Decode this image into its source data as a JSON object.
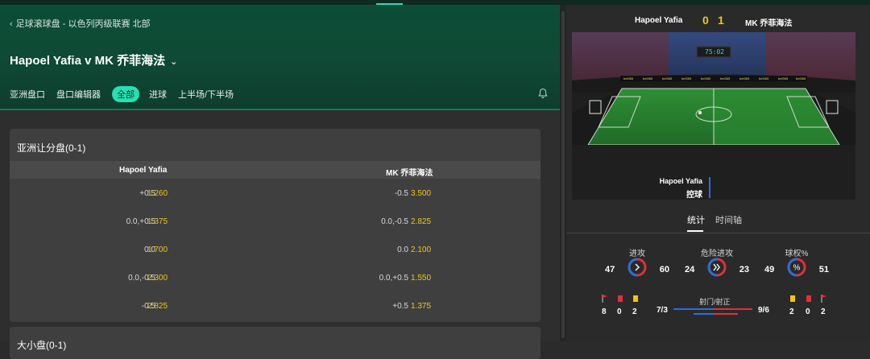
{
  "breadcrumb": "足球滚球盘 - 以色列丙级联赛 北部",
  "match_title": "Hapoel Yafia v MK 乔菲海法",
  "tabs": [
    {
      "label": "亚洲盘口",
      "active": false
    },
    {
      "label": "盘口编辑器",
      "active": false
    },
    {
      "label": "全部",
      "active": true
    },
    {
      "label": "进球",
      "active": false
    },
    {
      "label": "上半场/下半场",
      "active": false
    }
  ],
  "market": {
    "title": "亚洲让分盘(0-1)",
    "home_col": "Hapoel Yafia",
    "away_col": "MK 乔菲海法",
    "rows": [
      {
        "home_line": "+0.5",
        "home_odds": "1.260",
        "away_line": "-0.5",
        "away_odds": "3.500"
      },
      {
        "home_line": "0.0,+0.5",
        "home_odds": "1.375",
        "away_line": "0.0,-0.5",
        "away_odds": "2.825"
      },
      {
        "home_line": "0.0",
        "home_odds": "1.700",
        "away_line": "0.0",
        "away_odds": "2.100"
      },
      {
        "home_line": "0.0,-0.5",
        "home_odds": "2.300",
        "away_line": "0.0,+0.5",
        "away_odds": "1.550"
      },
      {
        "home_line": "-0.5",
        "home_odds": "2.825",
        "away_line": "+0.5",
        "away_odds": "1.375"
      }
    ]
  },
  "market2": {
    "title": "大小盘(0-1)"
  },
  "scoreboard": {
    "home": "Hapoel Yafia",
    "home_score": "0",
    "away_score": "1",
    "away": "MK 乔菲海法",
    "clock": "75:02"
  },
  "possession": {
    "team": "Hapoel Yafia",
    "state": "控球"
  },
  "right_tabs": [
    {
      "label": "统计",
      "active": true
    },
    {
      "label": "时间轴",
      "active": false
    }
  ],
  "stats": [
    {
      "label": "进攻",
      "home": "47",
      "away": "60",
      "icon": "chevron-right-icon"
    },
    {
      "label": "危险进攻",
      "home": "24",
      "away": "23",
      "icon": "double-chevron-icon"
    },
    {
      "label": "球权%",
      "home": "49",
      "away": "51",
      "icon": "percent-icon"
    }
  ],
  "bottom_stats": {
    "home_corners": "8",
    "home_red": "0",
    "home_yellow": "2",
    "shots_label": "射门/射正",
    "home_shots": "7/3",
    "away_shots": "9/6",
    "away_yellow": "2",
    "away_red": "0",
    "away_corners": "2"
  },
  "colors": {
    "accent": "#27e0b2",
    "odds": "#f2c419",
    "home": "#2b6fd6",
    "away": "#e0303a"
  }
}
